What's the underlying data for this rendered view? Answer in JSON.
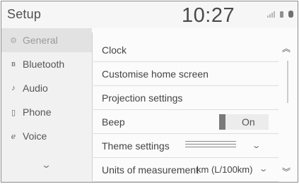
{
  "header": {
    "title": "Setup",
    "time": "10:27"
  },
  "status_icons": [
    "signal-icon",
    "battery-icon",
    "bluetooth-icon"
  ],
  "sidebar": {
    "items": [
      {
        "label": "General",
        "icon": "gear-icon",
        "active": true
      },
      {
        "label": "Bluetooth",
        "icon": "bluetooth-icon",
        "active": false
      },
      {
        "label": "Audio",
        "icon": "music-note-icon",
        "active": false
      },
      {
        "label": "Phone",
        "icon": "phone-icon",
        "active": false
      },
      {
        "label": "Voice",
        "icon": "voice-icon",
        "active": false
      }
    ],
    "more_icon": "chevron-down-icon"
  },
  "settings": {
    "clock": "Clock",
    "home": "Customise home screen",
    "projection": "Projection settings",
    "beep": {
      "label": "Beep",
      "value": "On"
    },
    "theme": "Theme settings",
    "units": {
      "label": "Units of measurement",
      "value": "km (L/100km)"
    }
  },
  "scroll": {
    "up_icon": "scroll-up-icon",
    "down_icon": "scroll-down-icon"
  }
}
